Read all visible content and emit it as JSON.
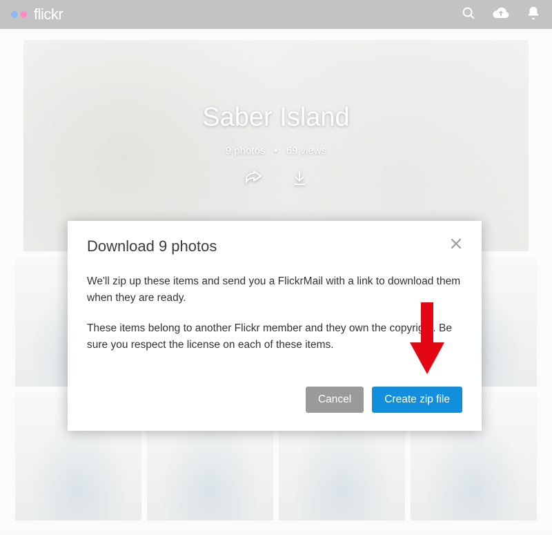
{
  "nav": {
    "brand": "flickr"
  },
  "hero": {
    "title": "Saber Island",
    "photos_count": "9 photos",
    "bullet": "•",
    "views": "69 views"
  },
  "modal": {
    "title": "Download 9 photos",
    "para1": "We'll zip up these items and send you a FlickrMail with a link to download them when they are ready.",
    "para2": "These items belong to another Flickr member and they own the copyright. Be sure you respect the license on each of these items.",
    "cancel": "Cancel",
    "create": "Create zip file"
  }
}
